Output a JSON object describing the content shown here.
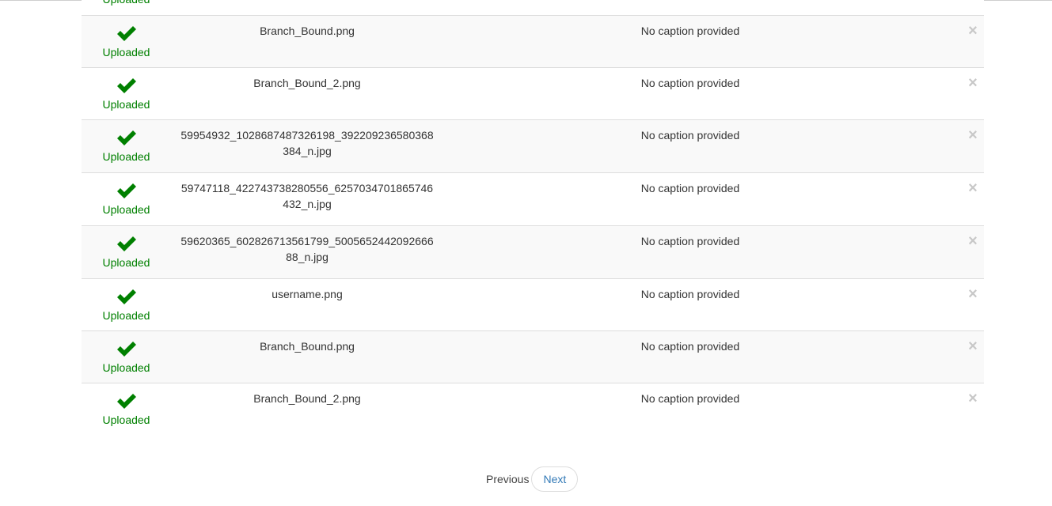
{
  "uploads": {
    "rows": [
      {
        "status": "Uploaded",
        "filename": "",
        "caption": ""
      },
      {
        "status": "Uploaded",
        "filename": "Branch_Bound.png",
        "caption": "No caption provided"
      },
      {
        "status": "Uploaded",
        "filename": "Branch_Bound_2.png",
        "caption": "No caption provided"
      },
      {
        "status": "Uploaded",
        "filename": "59954932_1028687487326198_392209236580368384_n.jpg",
        "caption": "No caption provided"
      },
      {
        "status": "Uploaded",
        "filename": "59747118_422743738280556_6257034701865746432_n.jpg",
        "caption": "No caption provided"
      },
      {
        "status": "Uploaded",
        "filename": "59620365_602826713561799_500565244209266688_n.jpg",
        "caption": "No caption provided"
      },
      {
        "status": "Uploaded",
        "filename": "username.png",
        "caption": "No caption provided"
      },
      {
        "status": "Uploaded",
        "filename": "Branch_Bound.png",
        "caption": "No caption provided"
      },
      {
        "status": "Uploaded",
        "filename": "Branch_Bound_2.png",
        "caption": "No caption provided"
      }
    ],
    "remove_symbol": "×"
  },
  "pagination": {
    "previous_label": "Previous",
    "next_label": "Next"
  },
  "colors": {
    "success": "#008000",
    "link": "#337ab7",
    "stripe": "#f9f9f9",
    "border": "#dddddd"
  },
  "icons": {
    "status": "checkmark-icon",
    "remove": "close-icon"
  }
}
